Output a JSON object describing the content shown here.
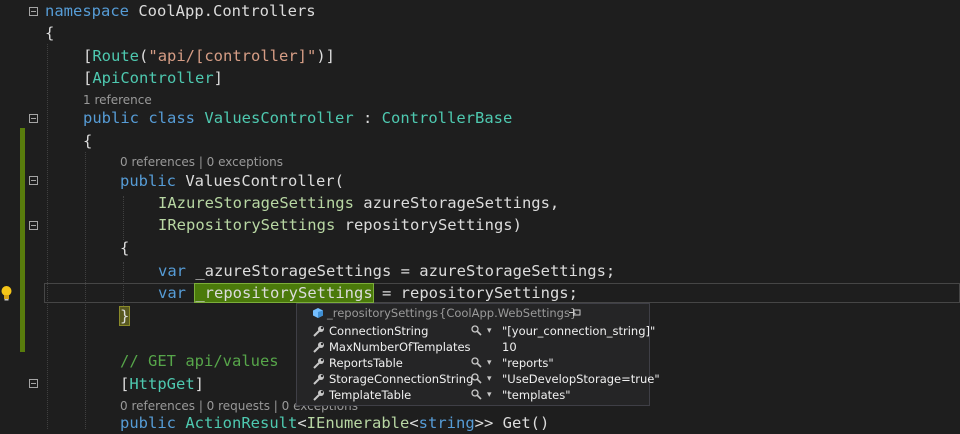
{
  "editor": {
    "lines": {
      "l1_kw": "namespace",
      "l1_rest": " CoolApp.Controllers",
      "l2": "{",
      "l3_a": "[",
      "l3_b": "Route",
      "l3_c": "(",
      "l3_d": "\"api/[controller]\"",
      "l3_e": ")]",
      "l4_a": "[",
      "l4_b": "ApiController",
      "l4_c": "]",
      "lens1": "1 reference",
      "l5_a": "public",
      "l5_b": " ",
      "l5_c": "class",
      "l5_d": " ",
      "l5_e": "ValuesController",
      "l5_f": " : ",
      "l5_g": "ControllerBase",
      "l6": "{",
      "lens2": "0 references | 0 exceptions",
      "l7_a": "public",
      "l7_b": " ValuesController(",
      "l8_a": "IAzureStorageSettings",
      "l8_b": " azureStorageSettings,",
      "l9_a": "IRepositorySettings",
      "l9_b": " repositorySettings)",
      "l10": "{",
      "l11_a": "var",
      "l11_b": " _azureStorageSettings = azureStorageSettings;",
      "l12_a": "var",
      "l12_b": " ",
      "l12_c": "_repositorySettings",
      "l12_d": " = repositorySettings;",
      "l13": "}",
      "l14": "// GET api/values",
      "l15_a": "[",
      "l15_b": "HttpGet",
      "l15_c": "]",
      "lens3": "0 references | 0 requests | 0 exceptions",
      "l16_a": "public",
      "l16_b": " ",
      "l16_c": "ActionResult",
      "l16_d": "<",
      "l16_e": "IEnumerable",
      "l16_f": "<",
      "l16_g": "string",
      "l16_h": ">> Get()"
    }
  },
  "datatip": {
    "variable": "_repositorySettings",
    "type": "{CoolApp.WebSettings}",
    "rows": [
      {
        "name": "ConnectionString",
        "value": "\"[your_connection_string]\"",
        "has_viewer": true
      },
      {
        "name": "MaxNumberOfTemplates",
        "value": "10",
        "has_viewer": false
      },
      {
        "name": "ReportsTable",
        "value": "\"reports\"",
        "has_viewer": true
      },
      {
        "name": "StorageConnectionString",
        "value": "\"UseDevelopStorage=true\"",
        "has_viewer": true
      },
      {
        "name": "TemplateTable",
        "value": "\"templates\"",
        "has_viewer": true
      }
    ]
  },
  "colors": {
    "background": "#1e1e1e",
    "keyword": "#569cd6",
    "type": "#4ec9b0",
    "interface": "#b8d7a3",
    "string": "#d69d85",
    "comment": "#57a64a",
    "change_bar": "#587c0c"
  },
  "icons": [
    "lightbulb-icon",
    "fold-toggle-icon",
    "cube-icon",
    "pin-icon",
    "wrench-icon",
    "magnifier-icon",
    "dropdown-caret-icon"
  ]
}
